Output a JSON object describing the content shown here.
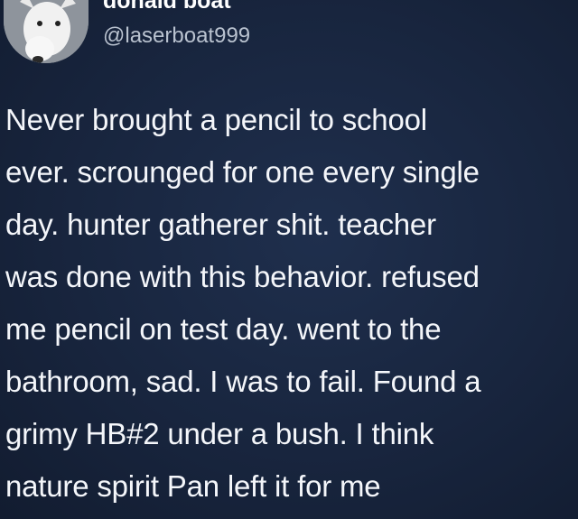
{
  "tweet": {
    "display_name": "donald boat",
    "handle": "@laserboat999",
    "avatar_icon": "dog-avatar-icon",
    "lines": [
      "Never brought a pencil to school",
      "ever. scrounged for one every single",
      "day. hunter gatherer shit. teacher",
      "was done with this behavior. refused",
      "me pencil on test day. went to the",
      "bathroom, sad. I was to fail. Found a",
      "grimy HB#2 under a bush. I think",
      "nature spirit Pan left it for me"
    ]
  },
  "colors": {
    "background": "#18253e",
    "text": "#f4f6fa",
    "handle": "#b9c2cf"
  }
}
